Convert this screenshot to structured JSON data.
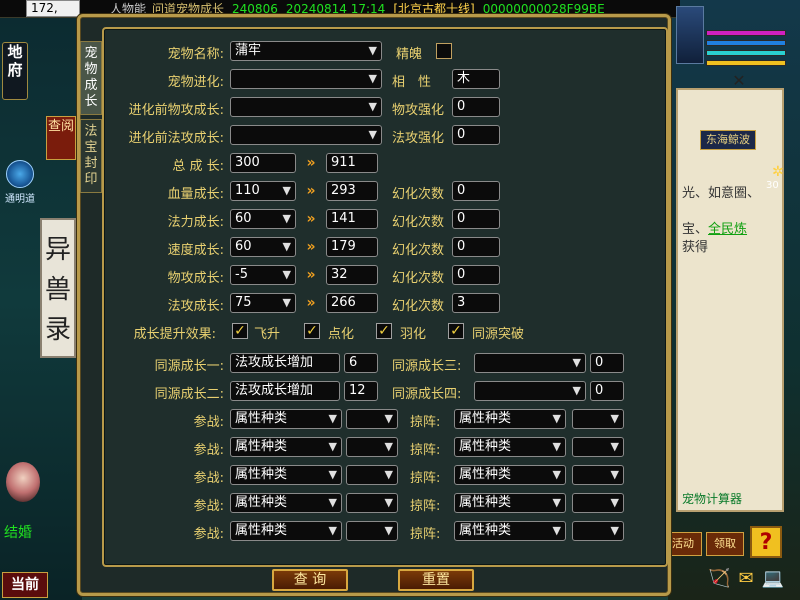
{
  "hud": {
    "coord": "172,",
    "status_player": "人物能",
    "status_tool": "问道宠物成长",
    "status_code": "240806",
    "status_date": "20240814 17:14",
    "status_server": "[北京古都十线]",
    "status_hex": "00000000028F99BE",
    "left_difu": "地府",
    "left_chayue": "查阅",
    "left_yishoulu": "异兽录",
    "left_compass_label": "通明道",
    "left_jiehun": "结婚",
    "left_dangqian": "当前",
    "right_sign": "东海鲸波",
    "right_line1": "光、如意圈、",
    "right_line2": "宝、",
    "right_line2_link": "全民炼",
    "right_line3": "获得",
    "right_calc": "宠物计算器",
    "right_stat": "30",
    "right_btn1": "活动",
    "right_btn2": "领取",
    "right_help": "?",
    "right_close": "✕",
    "bottom_icons": "🏹✉💻"
  },
  "window": {
    "title": "人物能 问道宠物成长",
    "tabs": [
      {
        "label": "宠物成长",
        "active": true
      },
      {
        "label": "法宝封印",
        "active": false
      }
    ]
  },
  "form": {
    "pet_name_label": "宠物名称:",
    "pet_name_value": "蒲牢",
    "jingpo_label": "精魄",
    "evolution_label": "宠物进化:",
    "evolution_value": "",
    "xiangxing_label": "相　性",
    "xiangxing_value": "木",
    "pre_phys_label": "进化前物攻成长:",
    "pre_phys_value": "",
    "phys_enhance_label": "物攻强化",
    "phys_enhance_value": "0",
    "pre_magic_label": "进化前法攻成长:",
    "pre_magic_value": "",
    "magic_enhance_label": "法攻强化",
    "magic_enhance_value": "0",
    "total_label": "总 成 长:",
    "total_base": "300",
    "total_result": "911",
    "huanhua_label": "幻化次数",
    "stats": [
      {
        "label": "血量成长:",
        "base": "110",
        "result": "293",
        "huanhua": "0"
      },
      {
        "label": "法力成长:",
        "base": "60",
        "result": "141",
        "huanhua": "0"
      },
      {
        "label": "速度成长:",
        "base": "60",
        "result": "179",
        "huanhua": "0"
      },
      {
        "label": "物攻成长:",
        "base": "-5",
        "result": "32",
        "huanhua": "0"
      },
      {
        "label": "法攻成长:",
        "base": "75",
        "result": "266",
        "huanhua": "3"
      }
    ],
    "boost_label": "成长提升效果:",
    "boosts": [
      {
        "label": "飞升",
        "checked": true
      },
      {
        "label": "点化",
        "checked": true
      },
      {
        "label": "羽化",
        "checked": true
      },
      {
        "label": "同源突破",
        "checked": true
      }
    ],
    "tongyuan1_label": "同源成长一:",
    "tongyuan1_value": "法攻成长增加",
    "tongyuan1_num": "6",
    "tongyuan2_label": "同源成长二:",
    "tongyuan2_value": "法攻成长增加",
    "tongyuan2_num": "12",
    "tongyuan3_label": "同源成长三:",
    "tongyuan3_value": "",
    "tongyuan3_num": "0",
    "tongyuan4_label": "同源成长四:",
    "tongyuan4_value": "",
    "tongyuan4_num": "0",
    "canzhan_label": "参战:",
    "lvezhen_label": "掠阵:",
    "attr_placeholder": "属性种类",
    "query_button": "查 询",
    "reset_button": "重置"
  }
}
